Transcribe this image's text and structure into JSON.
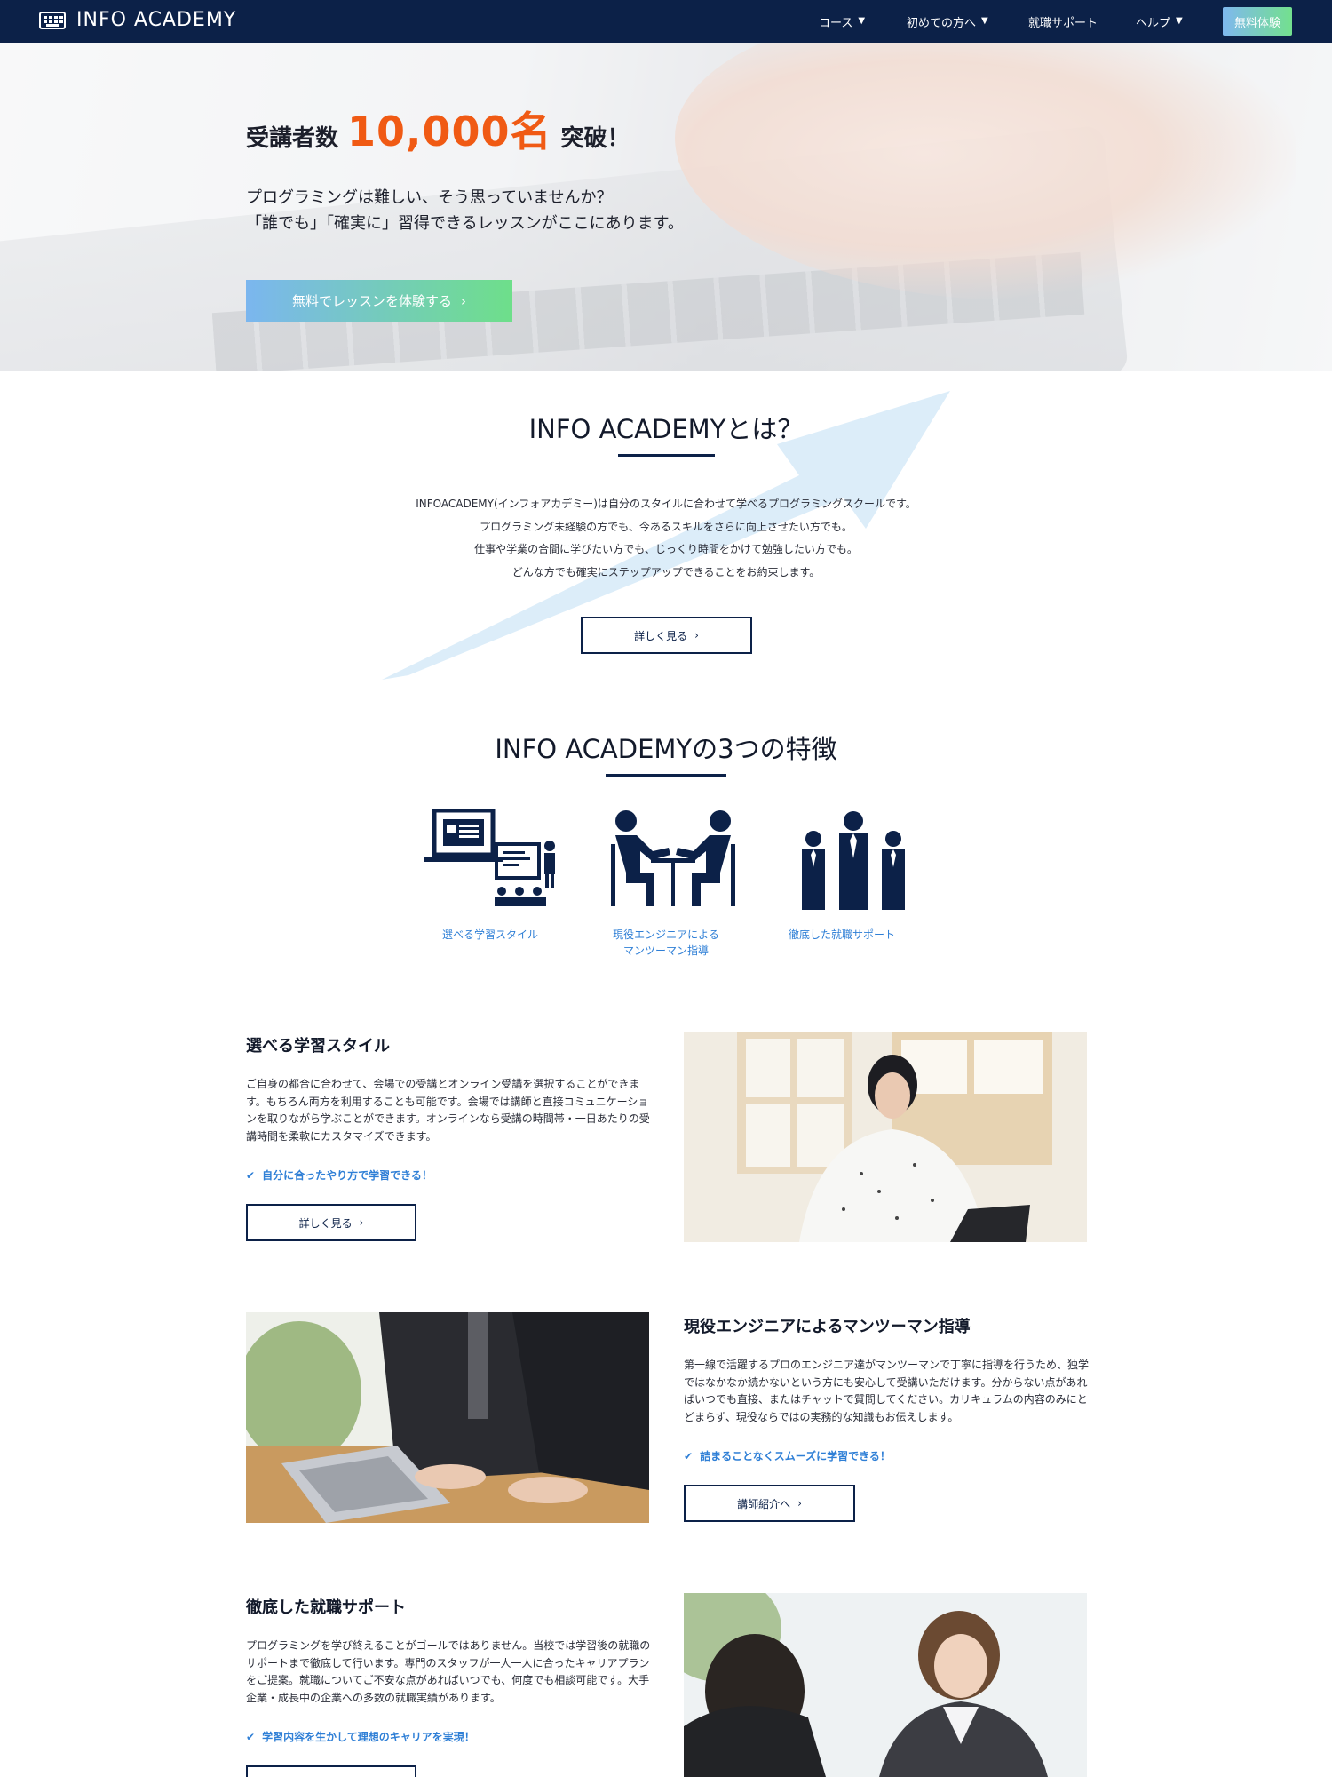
{
  "nav": {
    "logo": "INFO ACADEMY",
    "items": [
      "コース",
      "初めての方へ",
      "就職サポート",
      "ヘルプ"
    ],
    "cta": "無料体験"
  },
  "hero": {
    "prefix": "受講者数",
    "count": "10,000名",
    "suffix": "突破！",
    "line1": "プログラミングは難しい、そう思っていませんか？",
    "line2": "「誰でも」「確実に」習得できるレッスンがここにあります。",
    "cta": "無料でレッスンを体験する"
  },
  "about": {
    "title": "INFO ACADEMYとは？",
    "lines": [
      "INFOACADEMY(インフォアカデミー)は自分のスタイルに合わせて学べるプログラミングスクールです。",
      "プログラミング未経験の方でも、今あるスキルをさらに向上させたい方でも。",
      "仕事や学業の合間に学びたい方でも、じっくり時間をかけて勉強したい方でも。",
      "どんな方でも確実にステップアップできることをお約束します。"
    ],
    "button": "詳しく見る"
  },
  "features": {
    "title": "INFO ACADEMYの3つの特徴",
    "items": [
      {
        "label1": "選べる学習スタイル",
        "label2": ""
      },
      {
        "label1": "現役エンジニアによる",
        "label2": "マンツーマン指導"
      },
      {
        "label1": "徹底した就職サポート",
        "label2": ""
      }
    ]
  },
  "details": [
    {
      "title": "選べる学習スタイル",
      "body": "ご自身の都合に合わせて、会場での受講とオンライン受講を選択することができます。もちろん両方を利用することも可能です。会場では講師と直接コミュニケーションを取りながら学ぶことができます。オンラインなら受講の時間帯・一日あたりの受講時間を柔軟にカスタマイズできます。",
      "check": "自分に合ったやり方で学習できる！",
      "button": "詳しく見る"
    },
    {
      "title": "現役エンジニアによるマンツーマン指導",
      "body": "第一線で活躍するプロのエンジニア達がマンツーマンで丁寧に指導を行うため、独学ではなかなか続かないという方にも安心して受講いただけます。分からない点があればいつでも直接、またはチャットで質問してください。カリキュラムの内容のみにとどまらず、現役ならではの実務的な知識もお伝えします。",
      "check": "詰まることなくスムーズに学習できる！",
      "button": "講師紹介へ"
    },
    {
      "title": "徹底した就職サポート",
      "body": "プログラミングを学び終えることがゴールではありません。当校では学習後の就職のサポートまで徹底して行います。専門のスタッフが一人一人に合ったキャリアプランをご提案。就職についてご不安な点があればいつでも、何度でも相談可能です。大手企業・成長中の企業への多数の就職実績があります。",
      "check": "学習内容を生かして理想のキャリアを実現！"
    }
  ],
  "colors": {
    "navy": "#0c2148",
    "accent": "#f05a14",
    "link": "#2f7fd6",
    "cta_from": "#7bb6ef",
    "cta_to": "#6edf8a"
  },
  "icons": [
    "keyboard-icon",
    "chevron-down-icon",
    "chevron-right-icon",
    "check-icon",
    "teacher-icon",
    "mentoring-icon",
    "business-team-icon"
  ]
}
